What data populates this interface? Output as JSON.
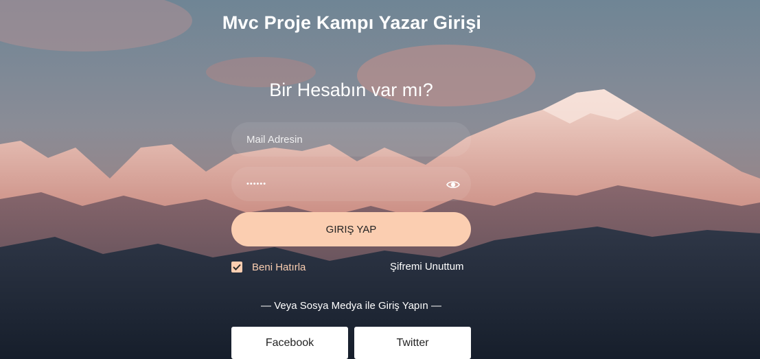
{
  "page": {
    "title": "Mvc Proje Kampı Yazar Girişi",
    "subtitle": "Bir Hesabın var mı?"
  },
  "form": {
    "email_placeholder": "Mail Adresin",
    "password_value": "******",
    "login_label": "GIRIŞ YAP",
    "remember_label": "Beni Hatırla",
    "remember_checked": true,
    "forgot_label": "Şifremi Unuttum"
  },
  "social": {
    "divider_text": "— Veya Sosya Medya ile Giriş Yapın —",
    "facebook_label": "Facebook",
    "twitter_label": "Twitter"
  },
  "icons": {
    "password_toggle": "eye-icon",
    "checkbox": "check-icon"
  },
  "colors": {
    "accent": "#fbceb1",
    "text": "#ffffff"
  }
}
